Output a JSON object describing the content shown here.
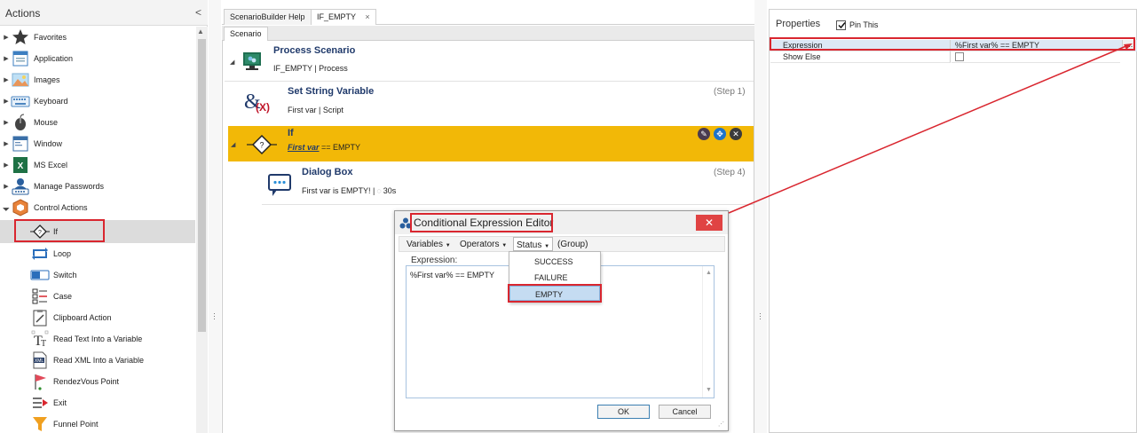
{
  "actions_panel": {
    "title": "Actions",
    "collapse_glyph": "<",
    "items": [
      {
        "label": "Favorites",
        "icon": "star-icon",
        "expandable": true
      },
      {
        "label": "Application",
        "icon": "application-icon",
        "expandable": true
      },
      {
        "label": "Images",
        "icon": "images-icon",
        "expandable": true
      },
      {
        "label": "Keyboard",
        "icon": "keyboard-icon",
        "expandable": true
      },
      {
        "label": "Mouse",
        "icon": "mouse-icon",
        "expandable": true
      },
      {
        "label": "Window",
        "icon": "window-icon",
        "expandable": true
      },
      {
        "label": "MS Excel",
        "icon": "excel-icon",
        "expandable": true
      },
      {
        "label": "Manage Passwords",
        "icon": "passwords-icon",
        "expandable": true
      },
      {
        "label": "Control Actions",
        "icon": "control-actions-icon",
        "expandable": true,
        "expanded": true
      },
      {
        "label": "If",
        "icon": "if-icon",
        "selected": true
      },
      {
        "label": "Loop",
        "icon": "loop-icon"
      },
      {
        "label": "Switch",
        "icon": "switch-icon"
      },
      {
        "label": "Case",
        "icon": "case-icon"
      },
      {
        "label": "Clipboard Action",
        "icon": "clipboard-icon"
      },
      {
        "label": "Read Text Into a Variable",
        "icon": "read-text-icon"
      },
      {
        "label": "Read XML Into a Variable",
        "icon": "read-xml-icon"
      },
      {
        "label": "RendezVous Point",
        "icon": "flag-icon"
      },
      {
        "label": "Exit",
        "icon": "exit-icon"
      },
      {
        "label": "Funnel Point",
        "icon": "funnel-icon"
      }
    ]
  },
  "center": {
    "tabs": [
      {
        "label": "ScenarioBuilder Help"
      },
      {
        "label": "IF_EMPTY",
        "close": "×"
      }
    ],
    "subtab": "Scenario",
    "steps": {
      "process": {
        "title": "Process Scenario",
        "subtitle": "IF_EMPTY | Process"
      },
      "set_string": {
        "title": "Set String Variable",
        "subtitle": "First var | Script",
        "step": "(Step 1)"
      },
      "if": {
        "title": "If",
        "variable": "First var",
        "condition": " == EMPTY"
      },
      "dialog": {
        "title": "Dialog Box",
        "subtitle_prefix": "First var is EMPTY! |",
        "timeout": "30s",
        "step": "(Step 4)"
      }
    }
  },
  "properties": {
    "title": "Properties",
    "pin_label": "Pin This",
    "pin_checked": true,
    "rows": [
      {
        "name": "Expression",
        "value": "%First var% == EMPTY",
        "ellipsis": "..."
      },
      {
        "name": "Show Else",
        "value": "",
        "checkbox": true
      }
    ]
  },
  "dialog": {
    "title": "Conditional Expression Editor",
    "close": "✕",
    "menus": [
      "Variables",
      "Operators",
      "Status",
      "(Group)"
    ],
    "expression_label": "Expression:",
    "expression_text": "%First var% == EMPTY",
    "ok": "OK",
    "cancel": "Cancel",
    "status_options": [
      "SUCCESS",
      "FAILURE",
      "EMPTY"
    ],
    "highlighted_option": "EMPTY"
  },
  "colors": {
    "if_highlight": "#f2b807",
    "annotation_red": "#d9262f",
    "title_blue": "#203a6b",
    "dialog_close": "#e04343"
  }
}
